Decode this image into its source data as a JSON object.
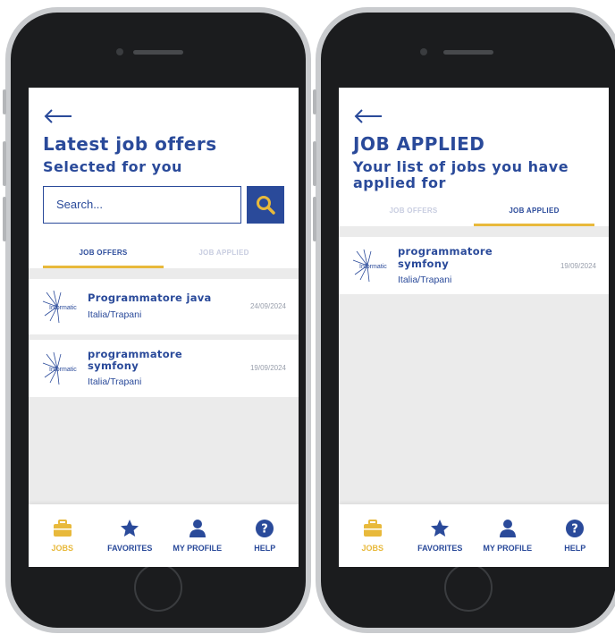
{
  "screen1": {
    "title": "Latest job offers",
    "subtitle": "Selected for you",
    "search_placeholder": "Search...",
    "tabs": [
      {
        "label": "JOB OFFERS",
        "active": true
      },
      {
        "label": "JOB APPLIED",
        "active": false
      }
    ],
    "jobs": [
      {
        "title": "Programmatore java",
        "location": "Italia/Trapani",
        "date": "24/09/2024",
        "logo_text": "Informatic"
      },
      {
        "title": "programmatore symfony",
        "location": "Italia/Trapani",
        "date": "19/09/2024",
        "logo_text": "Informatic"
      }
    ]
  },
  "screen2": {
    "title": "JOB APPLIED",
    "subtitle": "Your list of jobs you have applied for",
    "tabs": [
      {
        "label": "JOB OFFERS",
        "active": false
      },
      {
        "label": "JOB APPLIED",
        "active": true
      }
    ],
    "jobs": [
      {
        "title": "programmatore symfony",
        "location": "Italia/Trapani",
        "date": "19/09/2024",
        "logo_text": "Informatic"
      }
    ]
  },
  "navbar": {
    "items": [
      {
        "label": "JOBS",
        "icon": "briefcase-icon",
        "active": true
      },
      {
        "label": "FAVORITES",
        "icon": "star-icon",
        "active": false
      },
      {
        "label": "MY PROFILE",
        "icon": "user-icon",
        "active": false
      },
      {
        "label": "HELP",
        "icon": "help-icon",
        "active": false
      }
    ]
  },
  "colors": {
    "primary": "#2a4a9a",
    "accent": "#e8b93b",
    "background": "#ebebeb",
    "inactive_tab": "#c8cde0",
    "date_text": "#9aa0ad"
  }
}
